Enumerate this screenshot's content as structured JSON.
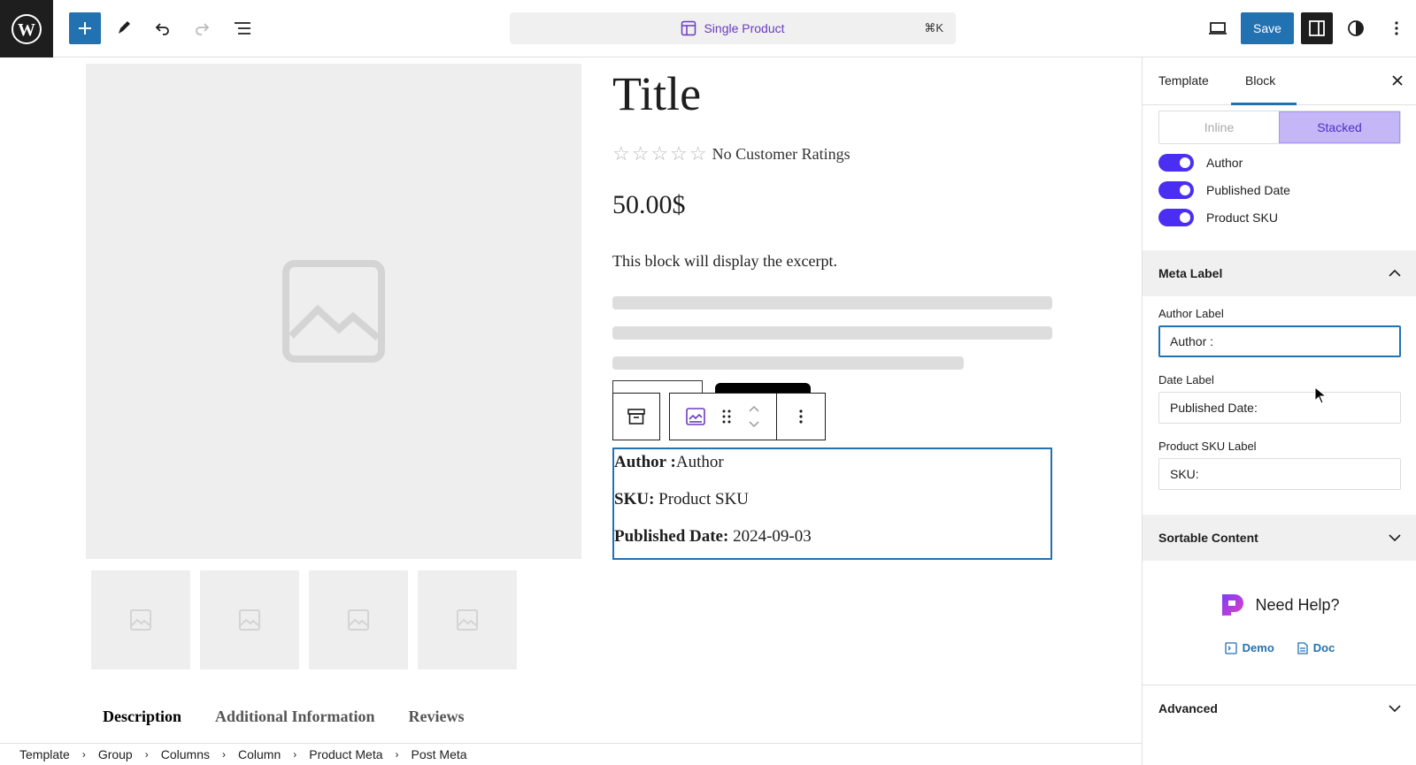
{
  "topbar": {
    "command_label": "Single Product",
    "command_kbd": "⌘K",
    "save_label": "Save"
  },
  "product": {
    "title": "Title",
    "ratings_label": "No Customer Ratings",
    "price": "50.00$",
    "excerpt": "This block will display the excerpt."
  },
  "meta": {
    "author_label": "Author :",
    "author_value": "Author",
    "sku_label": "SKU:",
    "sku_value": " Product SKU",
    "date_label": "Published Date:",
    "date_value": " 2024-09-03"
  },
  "product_tabs": [
    "Description",
    "Additional Information",
    "Reviews"
  ],
  "breadcrumb": [
    "Template",
    "Group",
    "Columns",
    "Column",
    "Product Meta",
    "Post Meta"
  ],
  "sidebar": {
    "tabs": [
      "Template",
      "Block"
    ],
    "layout_options": [
      "Inline",
      "Stacked"
    ],
    "toggles": [
      "Author",
      "Published Date",
      "Product SKU"
    ],
    "meta_label_panel": "Meta Label",
    "author_label_field": "Author Label",
    "author_label_value": "Author :",
    "date_label_field": "Date Label",
    "date_label_value": "Published Date:",
    "sku_label_field": "Product SKU Label",
    "sku_label_value": "SKU:",
    "sortable_panel": "Sortable Content",
    "help_title": "Need Help?",
    "demo_link": "Demo",
    "doc_link": "Doc",
    "advanced_panel": "Advanced"
  },
  "colors": {
    "accent": "#2271b1",
    "toggle": "#4a2ff2",
    "stacked_bg": "#c5b6f7"
  }
}
